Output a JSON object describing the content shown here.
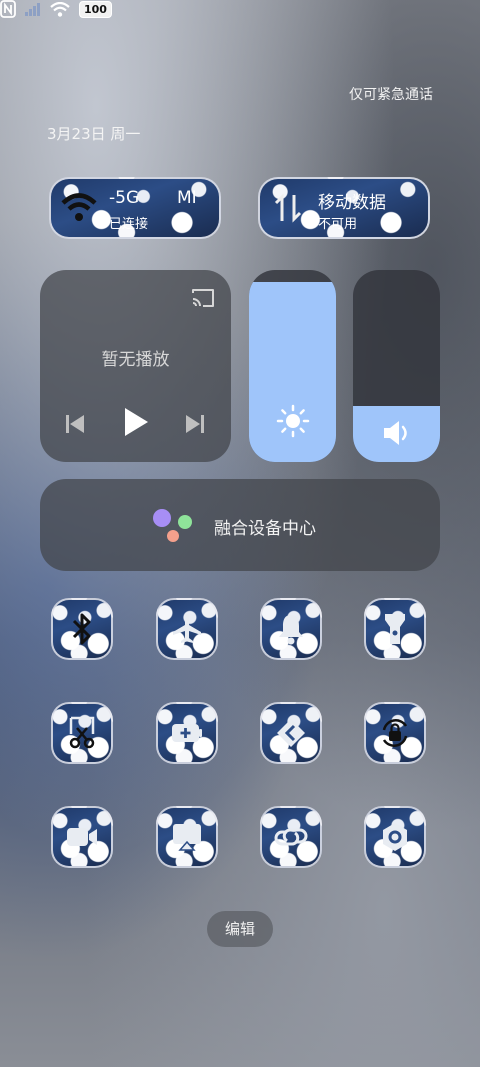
{
  "status_bar": {
    "emergency_text": "仅可紧急通话",
    "date_text": "3月23日 周一",
    "battery_level": "100",
    "icons": [
      "nfc-icon",
      "signal-icon",
      "wifi-icon",
      "battery-icon"
    ]
  },
  "network": {
    "wifi": {
      "title_left": "-5G",
      "title_right": "MI",
      "status": "已连接"
    },
    "mobile_data": {
      "title": "移动数据",
      "status": "不可用"
    }
  },
  "media": {
    "label": "暂无播放",
    "icons": [
      "cast-icon",
      "previous-icon",
      "play-icon",
      "next-icon"
    ]
  },
  "sliders": {
    "brightness": {
      "icon": "sun-icon",
      "level_percent": 94
    },
    "volume": {
      "icon": "speaker-icon",
      "level_percent": 29
    }
  },
  "fusion_center": {
    "label": "融合设备中心",
    "accent_colors": [
      "#a78ef5",
      "#8fe39a",
      "#f4a08c"
    ]
  },
  "toggles": [
    {
      "name": "bluetooth-icon"
    },
    {
      "name": "airplane-icon"
    },
    {
      "name": "bell-icon"
    },
    {
      "name": "flashlight-icon"
    },
    {
      "name": "screenshot-icon"
    },
    {
      "name": "battery-saver-icon"
    },
    {
      "name": "nearby-share-icon"
    },
    {
      "name": "rotation-lock-icon"
    },
    {
      "name": "screen-record-icon"
    },
    {
      "name": "screen-cast-icon"
    },
    {
      "name": "link-icon"
    },
    {
      "name": "settings-icon"
    }
  ],
  "edit_button": {
    "label": "编辑"
  },
  "accent_color": "#9fc5fa"
}
